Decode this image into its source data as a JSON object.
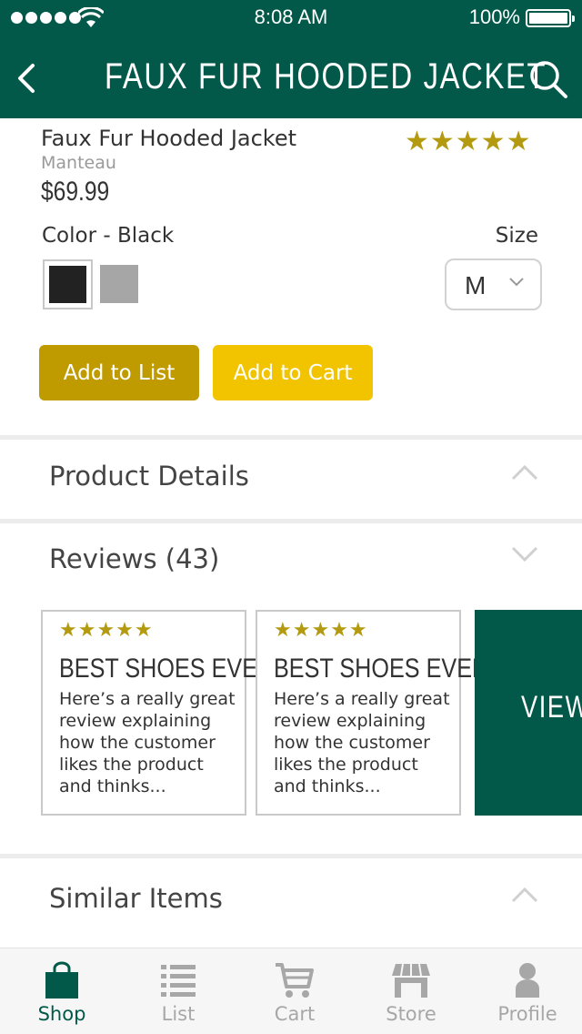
{
  "status_bar": {
    "time": "8:08 AM",
    "battery": "100%"
  },
  "header": {
    "title": "FAUX FUR HOODED JACKET"
  },
  "product": {
    "name": "Faux Fur Hooded Jacket",
    "brand": "Manteau",
    "price": "$69.99",
    "rating_stars": "★★★★★",
    "color_label": "Color - Black",
    "size_label": "Size",
    "size_value": "M",
    "colors": [
      "#222222",
      "#a6a6a6"
    ]
  },
  "actions": {
    "add_to_list": "Add to List",
    "add_to_cart": "Add to Cart"
  },
  "sections": {
    "product_details": "Product Details",
    "reviews": "Reviews (43)",
    "similar_items": "Similar Items"
  },
  "reviews": [
    {
      "stars": "★★★★★",
      "title": "BEST SHOES EVER",
      "body": "Here’s a really great review explaining how the customer likes the product and thinks..."
    },
    {
      "stars": "★★★★★",
      "title": "BEST SHOES EVER",
      "body": "Here’s a really great review explaining how the customer likes the product and thinks..."
    }
  ],
  "view_all_label": "VIEW",
  "tabs": [
    {
      "label": "Shop",
      "icon": "shopping-bag-icon",
      "active": true
    },
    {
      "label": "List",
      "icon": "list-icon",
      "active": false
    },
    {
      "label": "Cart",
      "icon": "cart-icon",
      "active": false
    },
    {
      "label": "Store",
      "icon": "store-icon",
      "active": false
    },
    {
      "label": "Profile",
      "icon": "profile-icon",
      "active": false
    }
  ],
  "colors": {
    "brand_green": "#02594a",
    "gold_dark": "#bf9b00",
    "gold": "#f2c400",
    "star": "#b39a10"
  }
}
